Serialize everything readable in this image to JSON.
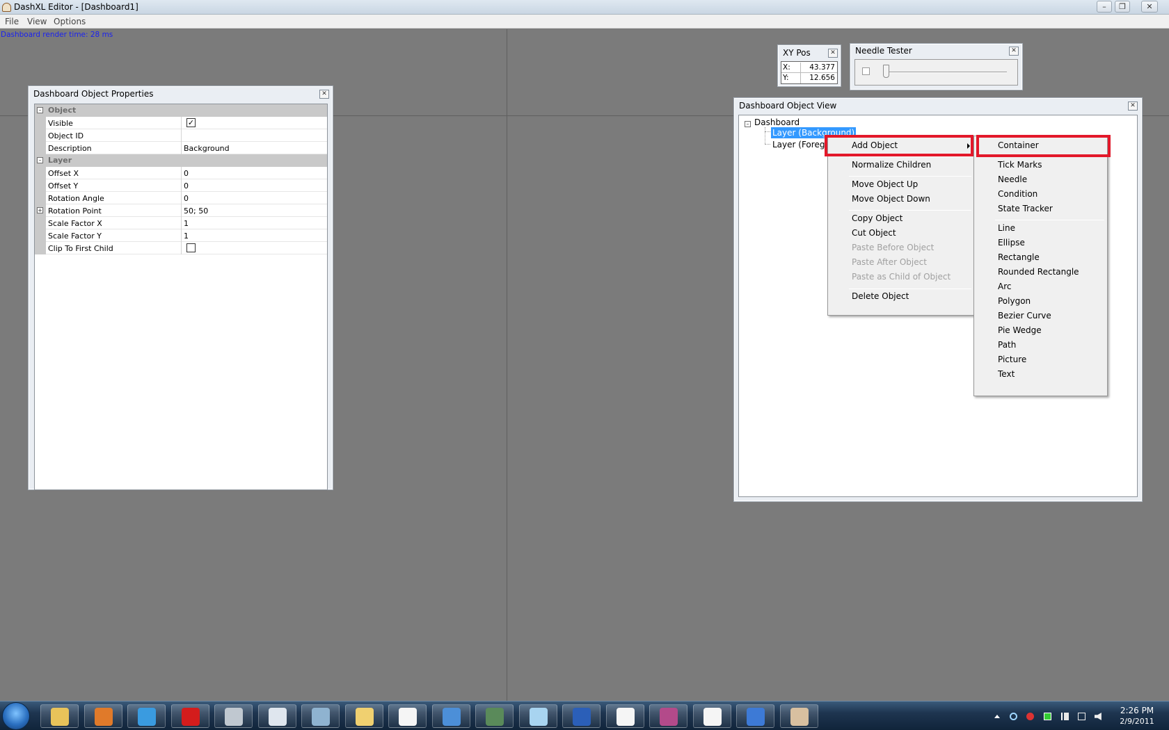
{
  "window": {
    "title": "DashXL Editor - [Dashboard1]"
  },
  "menubar": [
    "File",
    "View",
    "Options"
  ],
  "render_time": "Dashboard render time: 28 ms",
  "properties_panel": {
    "title": "Dashboard Object Properties",
    "categories": [
      {
        "name": "Object",
        "rows": [
          {
            "name": "Visible",
            "value": "",
            "checkbox": true,
            "checked": true
          },
          {
            "name": "Object ID",
            "value": ""
          },
          {
            "name": "Description",
            "value": "Background"
          }
        ]
      },
      {
        "name": "Layer",
        "rows": [
          {
            "name": "Offset X",
            "value": "0"
          },
          {
            "name": "Offset Y",
            "value": "0"
          },
          {
            "name": "Rotation Angle",
            "value": "0"
          },
          {
            "name": "Rotation Point",
            "value": "50; 50",
            "expandable": true
          },
          {
            "name": "Scale Factor X",
            "value": "1"
          },
          {
            "name": "Scale Factor Y",
            "value": "1"
          },
          {
            "name": "Clip To First Child",
            "value": "",
            "checkbox": true,
            "checked": false
          }
        ]
      }
    ]
  },
  "xy_pos": {
    "title": "XY Pos",
    "x_label": "X:",
    "x_value": "43.377",
    "y_label": "Y:",
    "y_value": "12.656"
  },
  "needle_tester": {
    "title": "Needle Tester"
  },
  "object_view": {
    "title": "Dashboard Object View",
    "tree": {
      "root": "Dashboard",
      "children": [
        "Layer (Background)",
        "Layer (Foreground)"
      ]
    }
  },
  "context_menu": {
    "items": [
      {
        "label": "Add Object",
        "submenu": true
      },
      {
        "label": "Normalize Children"
      },
      {
        "label": "Move Object Up"
      },
      {
        "label": "Move Object Down"
      },
      {
        "label": "Copy Object"
      },
      {
        "label": "Cut Object"
      },
      {
        "label": "Paste Before Object",
        "disabled": true
      },
      {
        "label": "Paste After Object",
        "disabled": true
      },
      {
        "label": "Paste as Child of Object",
        "disabled": true
      },
      {
        "label": "Delete Object"
      }
    ]
  },
  "add_object_submenu": {
    "items": [
      "Container",
      "Tick Marks",
      "Needle",
      "Condition",
      "State Tracker",
      "Line",
      "Ellipse",
      "Rectangle",
      "Rounded Rectangle",
      "Arc",
      "Polygon",
      "Bezier Curve",
      "Pie Wedge",
      "Path",
      "Picture",
      "Text"
    ]
  },
  "clock": {
    "time": "2:26 PM",
    "date": "2/9/2011"
  },
  "colors": {
    "highlight": "#e3182a",
    "selection": "#3399ff",
    "desktop": "#7b7b7b"
  }
}
